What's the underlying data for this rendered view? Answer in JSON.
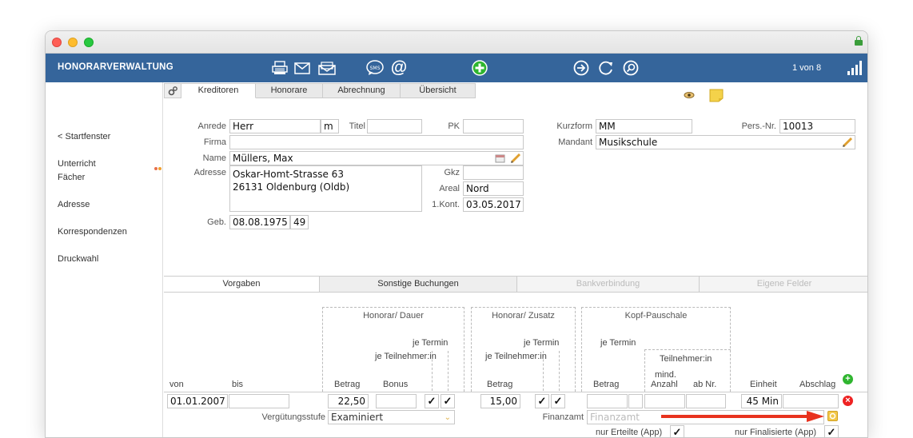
{
  "app": {
    "title": "HONORARVERWALTUNG",
    "record_counter": "1 von 8"
  },
  "toolbar": {
    "icons": [
      "printer-icon",
      "mail-icon",
      "mail-open-icon",
      "sms-icon",
      "at-icon",
      "add-icon",
      "forward-icon",
      "refresh-icon",
      "search-icon",
      "signal-bars-icon"
    ],
    "sms_label": "SMS",
    "at_label": "@"
  },
  "sidebar": {
    "items": [
      {
        "label": "< Startfenster"
      },
      {
        "label": "Unterricht"
      },
      {
        "label": "Fächer"
      },
      {
        "label": "Adresse"
      },
      {
        "label": "Korrespondenzen"
      },
      {
        "label": "Druckwahl"
      }
    ],
    "dot_colors": [
      "#e8704a",
      "#f0a030"
    ]
  },
  "tabs": [
    {
      "label": "Kreditoren",
      "active": true
    },
    {
      "label": "Honorare"
    },
    {
      "label": "Abrechnung"
    },
    {
      "label": "Übersicht"
    }
  ],
  "form": {
    "anrede_label": "Anrede",
    "anrede_value": "Herr",
    "gender_value": "m",
    "titel_label": "Titel",
    "titel_value": "",
    "pk_label": "PK",
    "pk_value": "",
    "firma_label": "Firma",
    "firma_value": "",
    "name_label": "Name",
    "name_value": "Müllers, Max",
    "adresse_label": "Adresse",
    "adresse_line1": "Oskar-Homt-Strasse 63",
    "adresse_line2": "26131 Oldenburg (Oldb)",
    "gkz_label": "Gkz",
    "gkz_value": "",
    "areal_label": "Areal",
    "areal_value": "Nord",
    "kont_label": "1.Kont.",
    "kont_value": "03.05.2017",
    "geb_label": "Geb.",
    "geb_value": "08.08.1975",
    "age_value": "49",
    "kurzform_label": "Kurzform",
    "kurzform_value": "MM",
    "persnr_label": "Pers.-Nr.",
    "persnr_value": "10013",
    "mandant_label": "Mandant",
    "mandant_value": "Musikschule"
  },
  "subtabs": [
    {
      "label": "Vorgaben",
      "active": true
    },
    {
      "label": "Sonstige Buchungen"
    },
    {
      "label": "Bankverbindung",
      "disabled": true
    },
    {
      "label": "Eigene Felder",
      "disabled": true
    }
  ],
  "vorgaben": {
    "group_honorar_dauer": "Honorar/ Dauer",
    "group_honorar_zusatz": "Honorar/ Zusatz",
    "group_kopf_pauschale": "Kopf-Pauschale",
    "je_termin": "je Termin",
    "je_teilnehmer": "je Teilnehmer:in",
    "teilnehmer": "Teilnehmer:in",
    "col_von": "von",
    "col_bis": "bis",
    "col_betrag": "Betrag",
    "col_bonus": "Bonus",
    "col_mind": "mind.",
    "col_anzahl": "Anzahl",
    "col_abnr": "ab Nr.",
    "col_einheit": "Einheit",
    "col_abschlag": "Abschlag",
    "row": {
      "von": "01.01.2007",
      "bis": "",
      "dauer_betrag": "22,50",
      "dauer_bonus": "",
      "check_mark": "✓",
      "zusatz_betrag": "15,00",
      "kopf_betrag": "",
      "kopf_mind": "",
      "kopf_abnr": "",
      "einheit": "45 Min",
      "abschlag": ""
    },
    "verguetungsstufe_label": "Vergütungsstufe",
    "verguetungsstufe_value": "Examiniert",
    "finanzamt_label": "Finanzamt",
    "finanzamt_placeholder": "Finanzamt",
    "nur_erteilte_label": "nur Erteilte (App)",
    "nur_finalisierte_label": "nur Finalisierte (App)",
    "arrow_color": "#e8321e"
  }
}
